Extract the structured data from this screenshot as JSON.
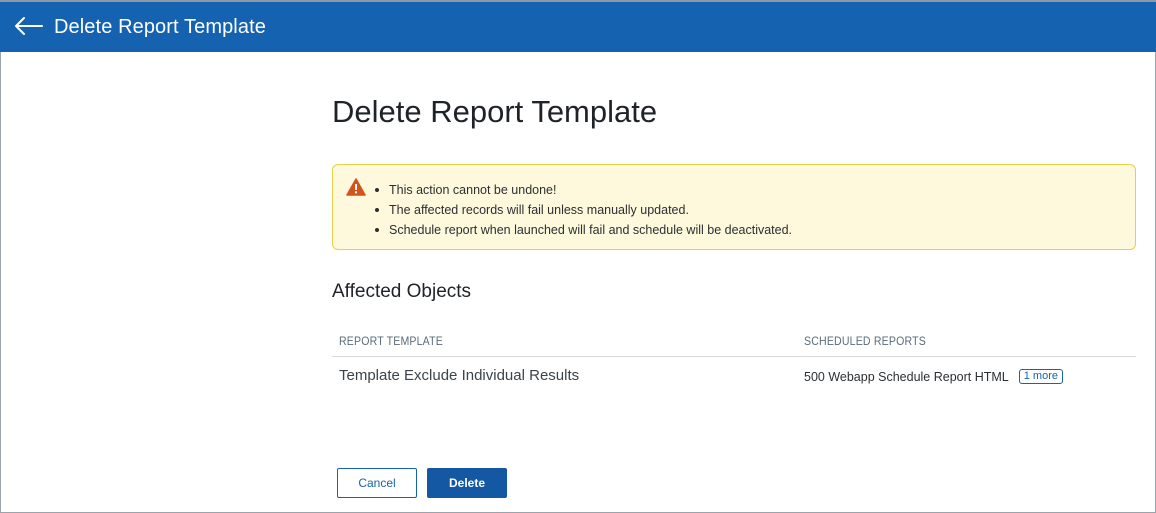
{
  "header": {
    "title": "Delete Report Template",
    "back_icon": "arrow-left-icon"
  },
  "main": {
    "title": "Delete Report Template",
    "warning": {
      "icon": "warning-triangle-icon",
      "items": [
        "This action cannot be undone!",
        "The affected records will fail unless manually updated.",
        "Schedule report when launched will fail and schedule will be deactivated."
      ]
    },
    "affected": {
      "title": "Affected Objects",
      "columns": [
        "REPORT TEMPLATE",
        "SCHEDULED REPORTS"
      ],
      "rows": [
        {
          "template": "Template Exclude Individual Results",
          "scheduled": "500 Webapp Schedule Report HTML",
          "more": "1 more"
        }
      ]
    },
    "actions": {
      "cancel_label": "Cancel",
      "delete_label": "Delete"
    }
  },
  "colors": {
    "header_bg": "#1562b0",
    "warning_bg": "#fef9dc",
    "warning_border": "#e9cf48",
    "warning_icon": "#d4531b",
    "primary": "#1457a2"
  }
}
